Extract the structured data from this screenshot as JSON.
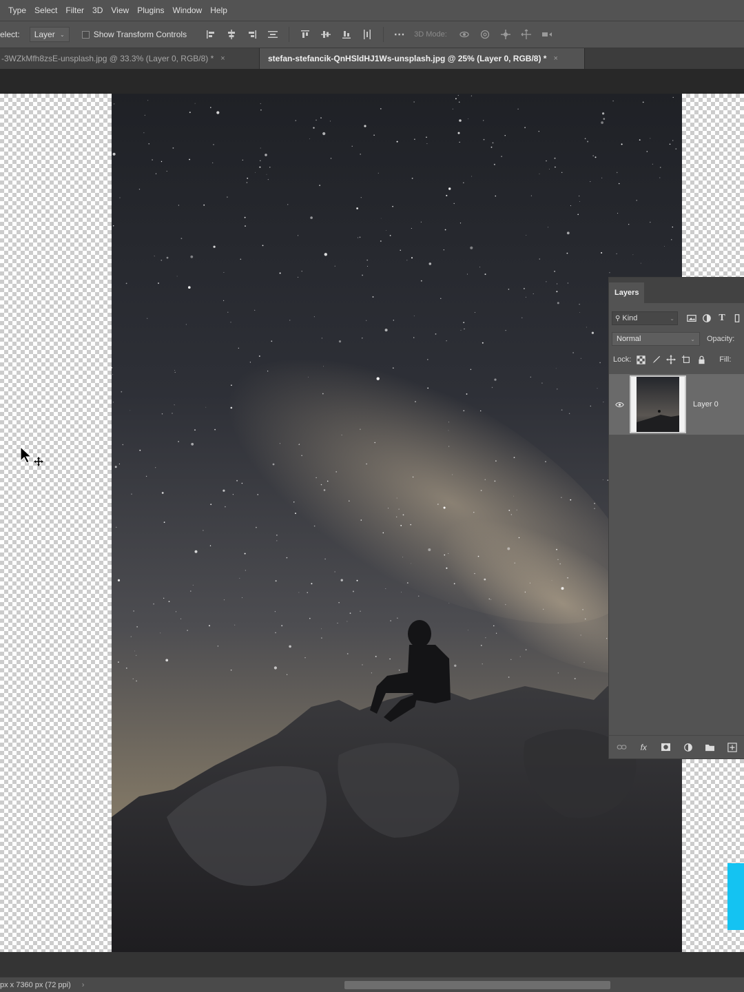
{
  "menubar": {
    "items": [
      "Type",
      "Select",
      "Filter",
      "3D",
      "View",
      "Plugins",
      "Window",
      "Help"
    ]
  },
  "options": {
    "select_label": "elect:",
    "select_value": "Layer",
    "show_transform": "Show Transform Controls",
    "mode_3d": "3D Mode:",
    "more_icon": "ellipsis-icon"
  },
  "tabs": [
    {
      "title": "-3WZkMfh8zsE-unsplash.jpg @ 33.3% (Layer 0, RGB/8) *",
      "close": "×"
    },
    {
      "title": "stefan-stefancik-QnHSldHJ1Ws-unsplash.jpg @ 25% (Layer 0, RGB/8) *",
      "close": "×"
    }
  ],
  "layers_panel": {
    "tab": "Layers",
    "kind": "Kind",
    "blend_mode": "Normal",
    "opacity_label": "Opacity:",
    "lock_label": "Lock:",
    "fill_label": "Fill:",
    "layer_name": "Layer 0"
  },
  "status": {
    "dimensions": "px x 7360 px (72 ppi)",
    "arrow": "›"
  },
  "colors": {
    "accent": "#14c3f2",
    "panel": "#535353",
    "workspace": "#282828"
  }
}
